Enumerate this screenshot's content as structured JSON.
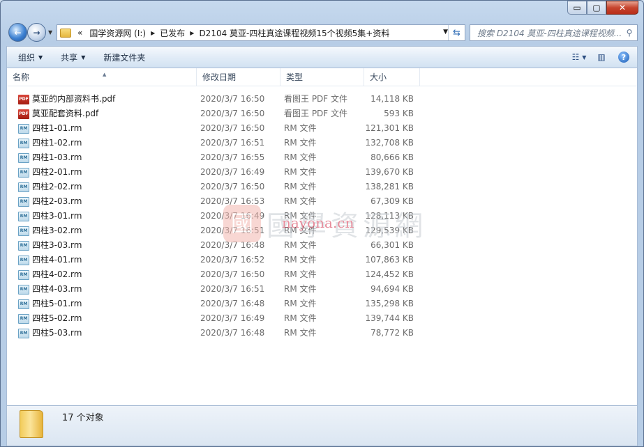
{
  "window": {
    "caption_buttons": {
      "minimize": "▭",
      "maximize": "▢",
      "close": "✕"
    }
  },
  "nav": {
    "back_icon": "arrow-left-icon",
    "forward_icon": "arrow-right-icon",
    "breadcrumbs": [
      "«",
      "国学资源网 (I:)",
      "已发布",
      "D2104 莫亚-四柱真途课程视频15个视频5集+资料"
    ],
    "search_placeholder": "搜索 D2104 莫亚-四柱真途课程视频..."
  },
  "toolbar": {
    "organize_label": "组织",
    "share_label": "共享",
    "new_folder_label": "新建文件夹"
  },
  "columns": {
    "name": "名称",
    "date": "修改日期",
    "type": "类型",
    "size": "大小"
  },
  "files": [
    {
      "icon": "PDF",
      "name": "莫亚的内部资料书.pdf",
      "date": "2020/3/7 16:50",
      "type": "看图王 PDF 文件",
      "size": "14,118 KB"
    },
    {
      "icon": "PDF",
      "name": "莫亚配套资料.pdf",
      "date": "2020/3/7 16:50",
      "type": "看图王 PDF 文件",
      "size": "593 KB"
    },
    {
      "icon": "RM",
      "name": "四柱1-01.rm",
      "date": "2020/3/7 16:50",
      "type": "RM 文件",
      "size": "121,301 KB"
    },
    {
      "icon": "RM",
      "name": "四柱1-02.rm",
      "date": "2020/3/7 16:51",
      "type": "RM 文件",
      "size": "132,708 KB"
    },
    {
      "icon": "RM",
      "name": "四柱1-03.rm",
      "date": "2020/3/7 16:55",
      "type": "RM 文件",
      "size": "80,666 KB"
    },
    {
      "icon": "RM",
      "name": "四柱2-01.rm",
      "date": "2020/3/7 16:49",
      "type": "RM 文件",
      "size": "139,670 KB"
    },
    {
      "icon": "RM",
      "name": "四柱2-02.rm",
      "date": "2020/3/7 16:50",
      "type": "RM 文件",
      "size": "138,281 KB"
    },
    {
      "icon": "RM",
      "name": "四柱2-03.rm",
      "date": "2020/3/7 16:53",
      "type": "RM 文件",
      "size": "67,309 KB"
    },
    {
      "icon": "RM",
      "name": "四柱3-01.rm",
      "date": "2020/3/7 16:49",
      "type": "RM 文件",
      "size": "128,113 KB"
    },
    {
      "icon": "RM",
      "name": "四柱3-02.rm",
      "date": "2020/3/7 16:51",
      "type": "RM 文件",
      "size": "129,539 KB"
    },
    {
      "icon": "RM",
      "name": "四柱3-03.rm",
      "date": "2020/3/7 16:48",
      "type": "RM 文件",
      "size": "66,301 KB"
    },
    {
      "icon": "RM",
      "name": "四柱4-01.rm",
      "date": "2020/3/7 16:52",
      "type": "RM 文件",
      "size": "107,863 KB"
    },
    {
      "icon": "RM",
      "name": "四柱4-02.rm",
      "date": "2020/3/7 16:50",
      "type": "RM 文件",
      "size": "124,452 KB"
    },
    {
      "icon": "RM",
      "name": "四柱4-03.rm",
      "date": "2020/3/7 16:51",
      "type": "RM 文件",
      "size": "94,694 KB"
    },
    {
      "icon": "RM",
      "name": "四柱5-01.rm",
      "date": "2020/3/7 16:48",
      "type": "RM 文件",
      "size": "135,298 KB"
    },
    {
      "icon": "RM",
      "name": "四柱5-02.rm",
      "date": "2020/3/7 16:49",
      "type": "RM 文件",
      "size": "139,744 KB"
    },
    {
      "icon": "RM",
      "name": "四柱5-03.rm",
      "date": "2020/3/7 16:48",
      "type": "RM 文件",
      "size": "78,772 KB"
    }
  ],
  "watermark": {
    "logo": "國",
    "text": "國學資源網",
    "url": "nayona.cn"
  },
  "status": {
    "count_text": "17 个对象"
  }
}
